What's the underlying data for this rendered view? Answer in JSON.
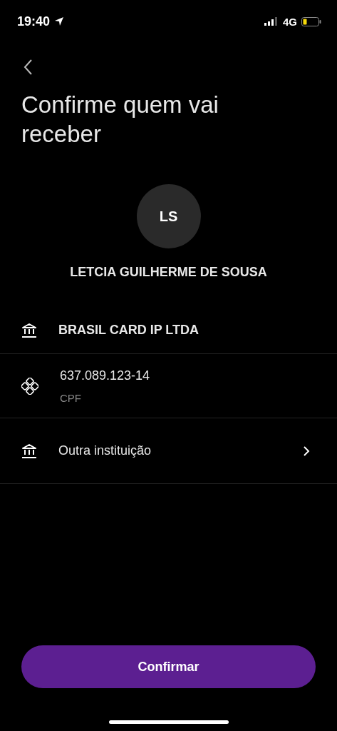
{
  "status_bar": {
    "time": "19:40",
    "network": "4G"
  },
  "title": "Confirme quem vai receber",
  "recipient": {
    "initials": "LS",
    "name": "LETCIA GUILHERME DE SOUSA"
  },
  "rows": [
    {
      "kind": "bank",
      "label": "BRASIL CARD IP LTDA"
    },
    {
      "kind": "pix",
      "label": "637.089.123-14",
      "sublabel": "CPF"
    },
    {
      "kind": "link",
      "label": "Outra instituição"
    }
  ],
  "button": "Confirmar"
}
